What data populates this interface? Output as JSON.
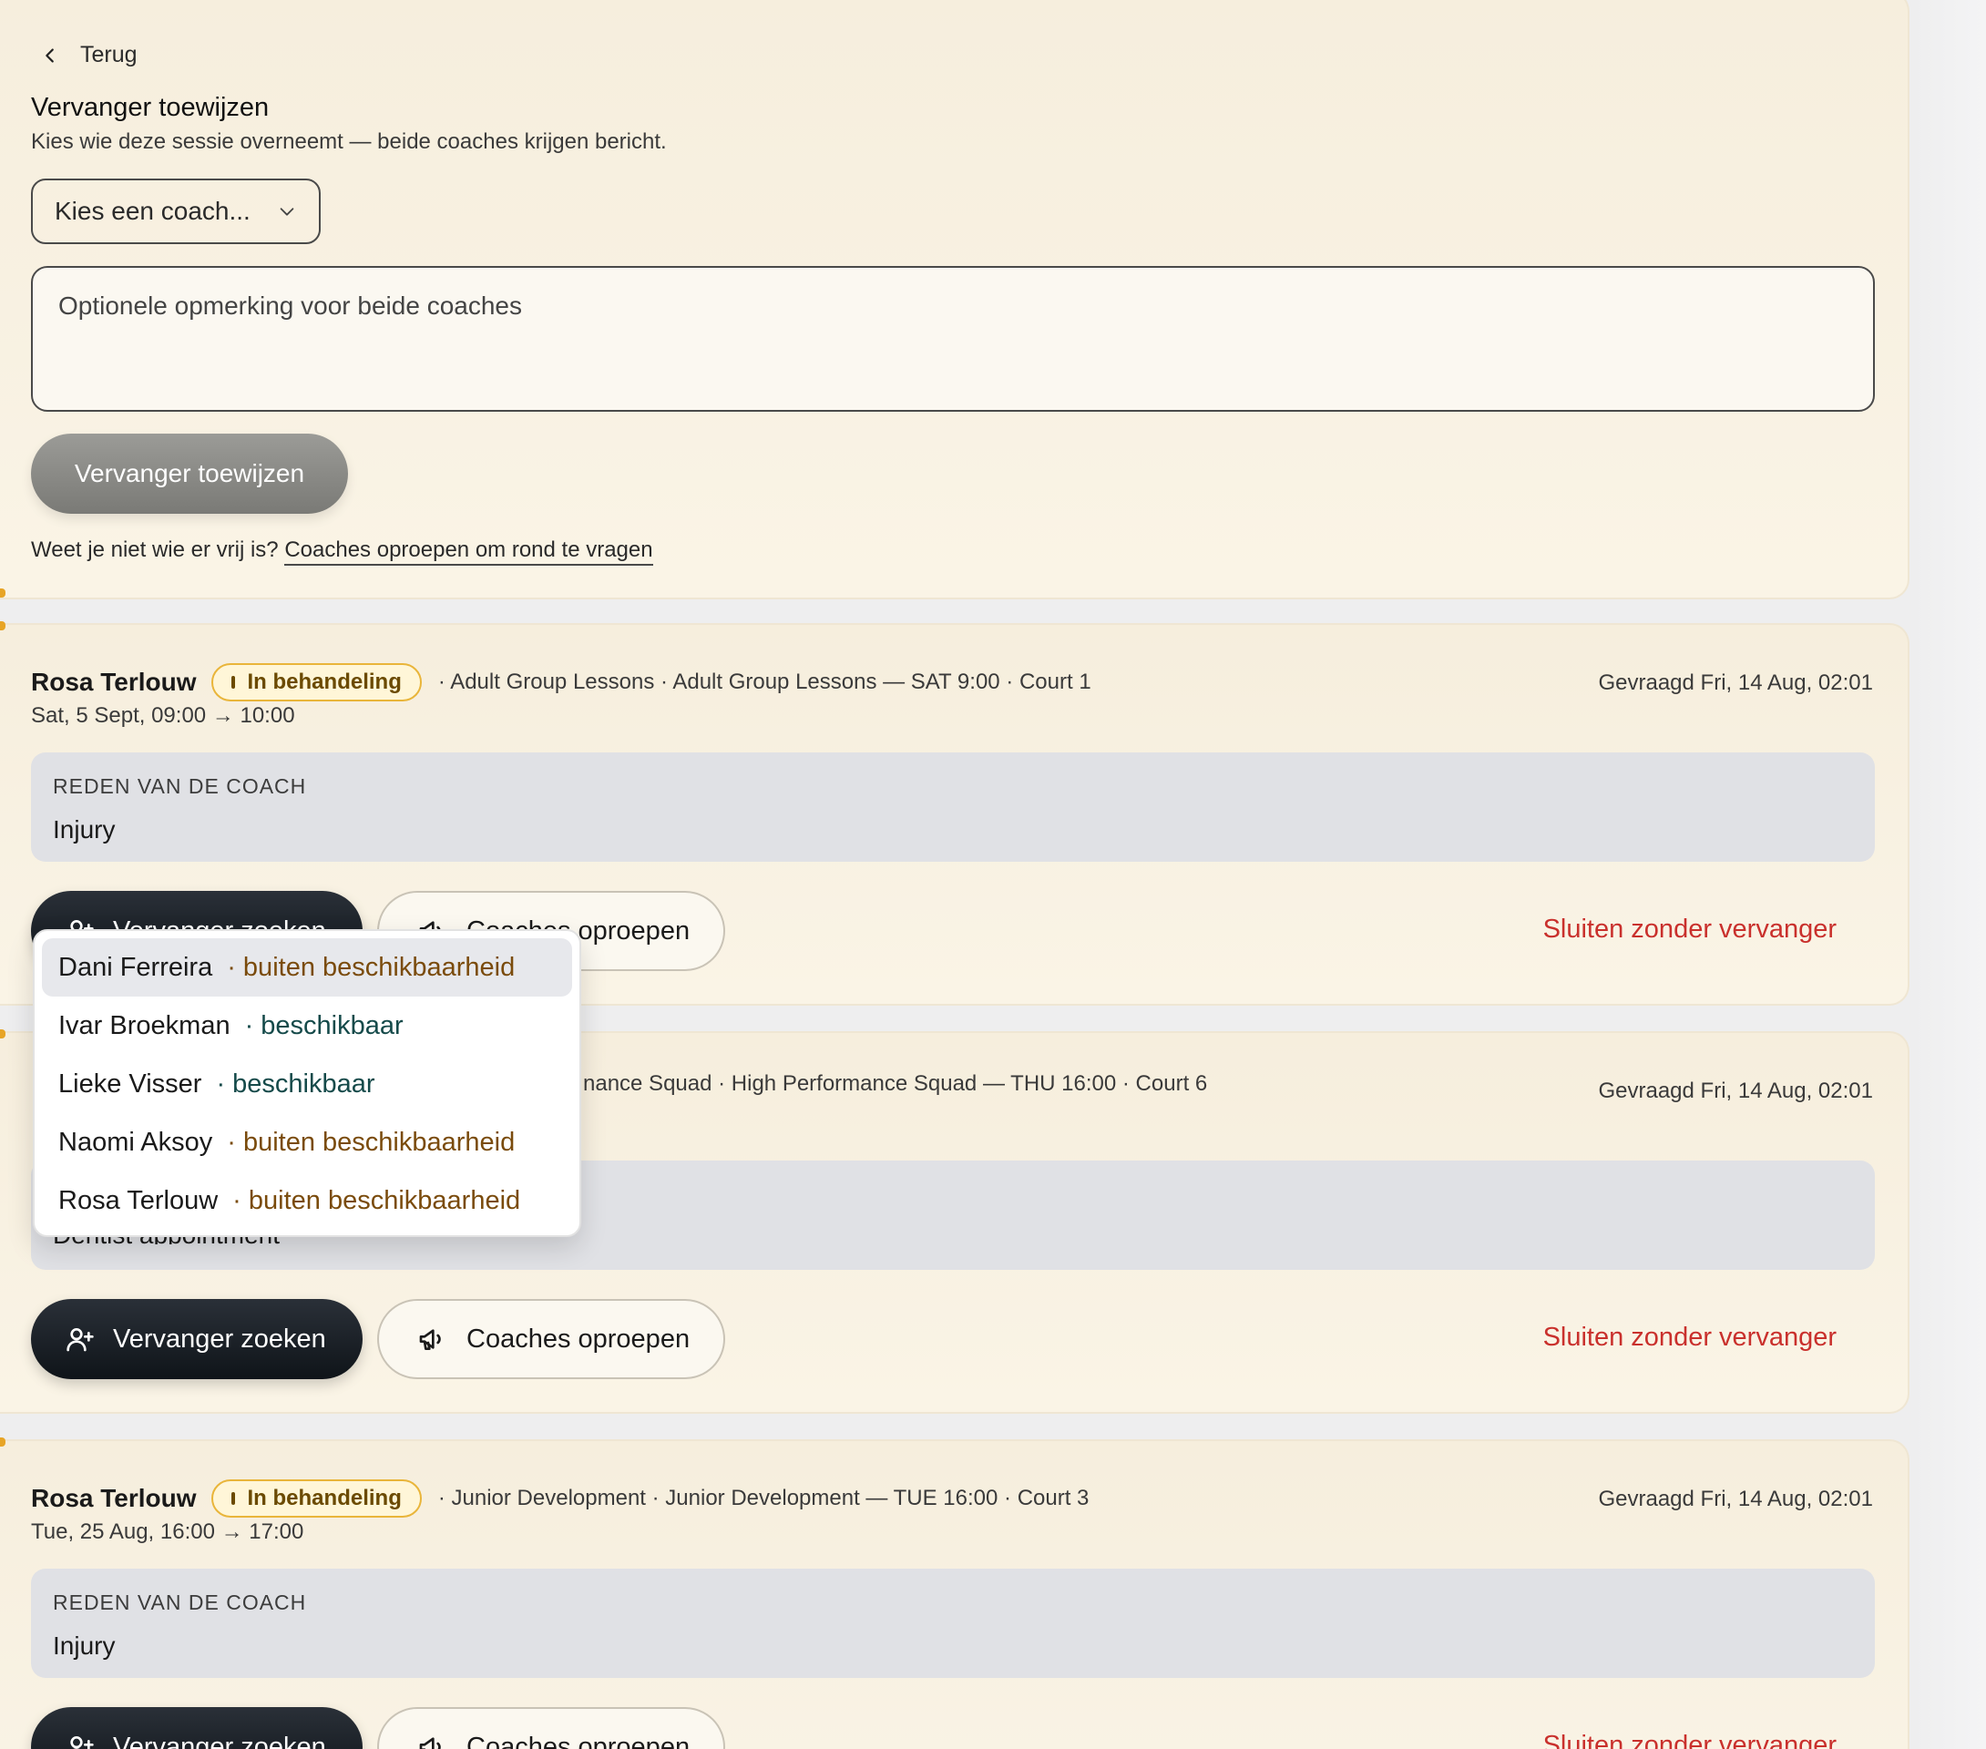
{
  "top_panel": {
    "back_label": "Terug",
    "title": "Vervanger toewijzen",
    "subtitle": "Kies wie deze sessie overneemt — beide coaches krijgen bericht.",
    "select_placeholder": "Kies een coach...",
    "remark_placeholder": "Optionele opmerking voor beide coaches",
    "assign_button": "Vervanger toewijzen",
    "hint_text": "Weet je niet wie er vrij is? ",
    "hint_link": "Coaches oproepen om rond te vragen"
  },
  "requests": [
    {
      "coach": "Rosa Terlouw",
      "status": "In behandeling",
      "meta": "· Adult Group Lessons · Adult Group Lessons — SAT 9:00 · Court 1",
      "date": "Sat, 5 Sept, 09:00 → 10:00",
      "asked": "Gevraagd Fri, 14 Aug, 02:01",
      "reason_label": "REDEN VAN DE COACH",
      "reason": "Injury",
      "find_button": "Vervanger zoeken",
      "call_button": "Coaches oproepen",
      "close_button": "Sluiten zonder vervanger"
    },
    {
      "coach": "",
      "status": "",
      "meta": "nance Squad · High Performance Squad — THU 16:00 · Court 6",
      "date": "",
      "asked": "Gevraagd Fri, 14 Aug, 02:01",
      "reason_label": "",
      "reason": "Dentist appointment",
      "find_button": "Vervanger zoeken",
      "call_button": "Coaches oproepen",
      "close_button": "Sluiten zonder vervanger"
    },
    {
      "coach": "Rosa Terlouw",
      "status": "In behandeling",
      "meta": "· Junior Development · Junior Development — TUE 16:00 · Court 3",
      "date": "Tue, 25 Aug, 16:00 → 17:00",
      "asked": "Gevraagd Fri, 14 Aug, 02:01",
      "reason_label": "REDEN VAN DE COACH",
      "reason": "Injury",
      "find_button": "Vervanger zoeken",
      "call_button": "Coaches oproepen",
      "close_button": "Sluiten zonder vervanger"
    }
  ],
  "dropdown": {
    "items": [
      {
        "name": "Dani Ferreira",
        "status": "· buiten beschikbaarheid"
      },
      {
        "name": "Ivar Broekman",
        "status": "· beschikbaar"
      },
      {
        "name": "Lieke Visser",
        "status": "· beschikbaar"
      },
      {
        "name": "Naomi Aksoy",
        "status": "· buiten beschikbaarheid"
      },
      {
        "name": "Rosa Terlouw",
        "status": "· buiten beschikbaarheid"
      }
    ]
  },
  "colors": {
    "accent": "#e7a426",
    "danger": "#c9302c",
    "primary_button": "#0f1419",
    "unavailable": "#7a4b0c",
    "available": "#154a4a"
  },
  "icons": [
    "chevron-left-icon",
    "chevron-down-icon",
    "user-plus-icon",
    "megaphone-icon",
    "alert-icon"
  ]
}
